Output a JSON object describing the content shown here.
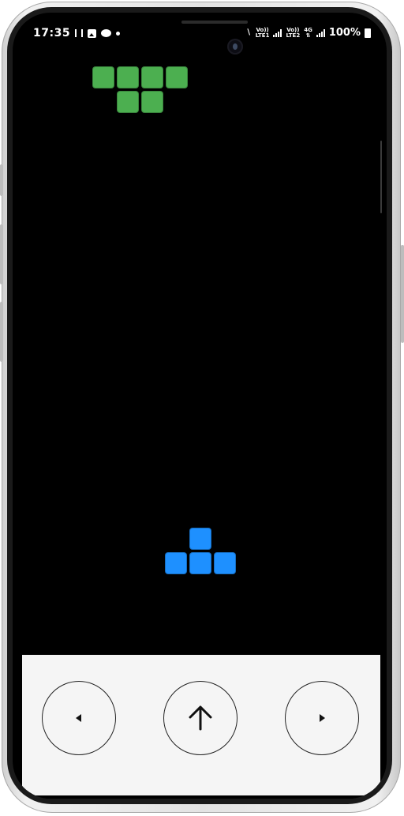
{
  "status_bar": {
    "time": "17:35",
    "left_icons": [
      "screen-record-icon",
      "gallery-icon",
      "chat-icon",
      "notification-dot-icon"
    ],
    "sim1_label_top": "Vo))",
    "sim1_label_bottom": "LTE1",
    "sim2_label_top": "Vo))",
    "sim2_label_bottom": "LTE2",
    "network_type": "4G",
    "battery": "100%"
  },
  "game": {
    "falling_piece": {
      "shape": "T",
      "color": "#4caf50",
      "cells": [
        [
          0,
          0
        ],
        [
          1,
          0
        ],
        [
          2,
          0
        ],
        [
          3,
          0
        ],
        [
          1,
          1
        ],
        [
          2,
          1
        ]
      ]
    },
    "player_piece": {
      "shape": "T",
      "color": "#1e90ff",
      "cells": [
        [
          1,
          0
        ],
        [
          0,
          1
        ],
        [
          1,
          1
        ],
        [
          2,
          1
        ]
      ]
    }
  },
  "controls": {
    "left": "left-arrow-icon",
    "rotate": "up-arrow-icon",
    "right": "right-arrow-icon"
  },
  "colors": {
    "screen_bg": "#000000",
    "controls_bg": "#f5f5f5",
    "button_border": "#222222"
  }
}
